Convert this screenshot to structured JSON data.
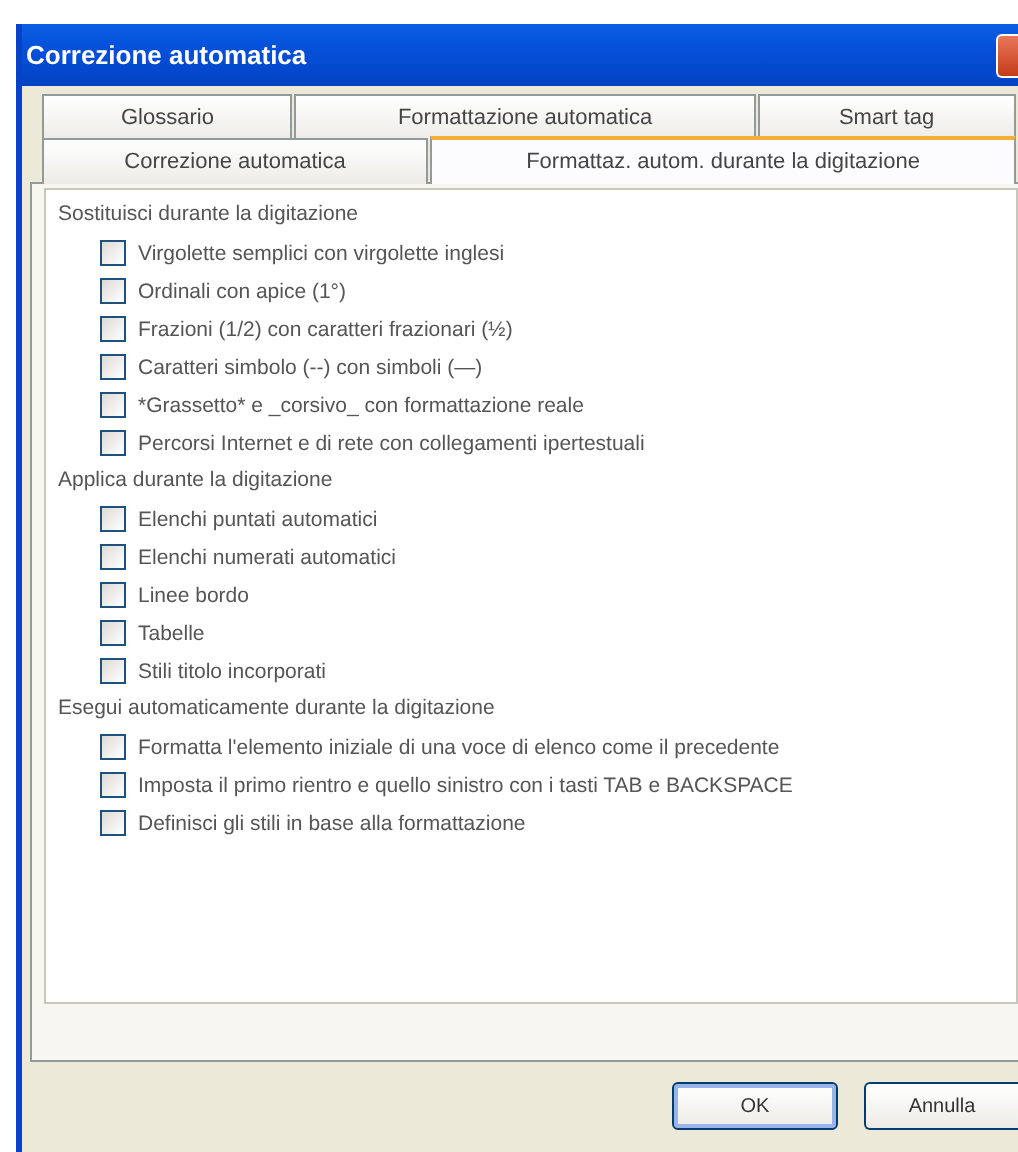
{
  "window": {
    "title": "Correzione automatica"
  },
  "tab_rows": [
    {
      "tabs": [
        {
          "label": "Glossario",
          "selected": false
        },
        {
          "label": "Formattazione automatica",
          "selected": false
        },
        {
          "label": "Smart tag",
          "selected": false
        }
      ]
    },
    {
      "tabs": [
        {
          "label": "Correzione automatica",
          "selected": false
        },
        {
          "label": "Formattaz. autom. durante la digitazione",
          "selected": true
        }
      ]
    }
  ],
  "sections": [
    {
      "heading": "Sostituisci durante la digitazione",
      "options": [
        {
          "label": "Virgolette semplici con virgolette inglesi",
          "checked": false
        },
        {
          "label": "Ordinali con apice (1°)",
          "checked": false
        },
        {
          "label": "Frazioni (1/2) con caratteri frazionari (½)",
          "checked": false
        },
        {
          "label": "Caratteri simbolo (--) con simboli (—)",
          "checked": false
        },
        {
          "label": "*Grassetto* e _corsivo_ con formattazione reale",
          "checked": false
        },
        {
          "label": "Percorsi Internet e di rete con collegamenti ipertestuali",
          "checked": false
        }
      ]
    },
    {
      "heading": "Applica durante la digitazione",
      "options": [
        {
          "label": "Elenchi puntati automatici",
          "checked": false
        },
        {
          "label": "Elenchi numerati automatici",
          "checked": false
        },
        {
          "label": "Linee bordo",
          "checked": false
        },
        {
          "label": "Tabelle",
          "checked": false
        },
        {
          "label": "Stili titolo incorporati",
          "checked": false
        }
      ]
    },
    {
      "heading": "Esegui automaticamente durante la digitazione",
      "options": [
        {
          "label": "Formatta l'elemento iniziale di una voce di elenco come il precedente",
          "checked": false
        },
        {
          "label": "Imposta il primo rientro e quello sinistro con i tasti TAB e BACKSPACE",
          "checked": false
        },
        {
          "label": "Definisci gli stili in base alla formattazione",
          "checked": false
        }
      ]
    }
  ],
  "buttons": [
    {
      "label": "OK",
      "kind": "default"
    },
    {
      "label": "Annulla",
      "kind": "normal"
    }
  ]
}
